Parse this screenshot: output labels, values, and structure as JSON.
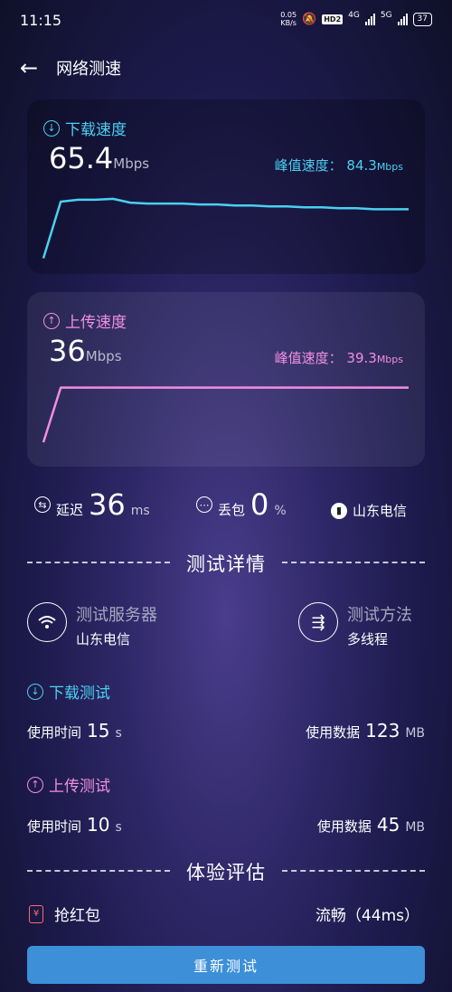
{
  "status_bar": {
    "time": "11:15",
    "net_speed_value": "0.05",
    "net_speed_unit": "KB/s",
    "hd_badge": "HD2",
    "network_1": "4G",
    "network_2": "5G",
    "battery": "37"
  },
  "header": {
    "title": "网络测速",
    "back_icon": "arrow-left-icon"
  },
  "download_card": {
    "label": "下载速度",
    "value": "65.4",
    "unit": "Mbps",
    "peak_label": "峰值速度：",
    "peak_value": "84.3",
    "peak_unit": "Mbps",
    "color": "#49d1f0"
  },
  "upload_card": {
    "label": "上传速度",
    "value": "36",
    "unit": "Mbps",
    "peak_label": "峰值速度：",
    "peak_value": "39.3",
    "peak_unit": "Mbps",
    "color": "#f08fe0"
  },
  "chart_data": [
    {
      "type": "line",
      "series": [
        {
          "values": [
            8,
            68,
            70,
            70,
            71,
            67,
            66,
            66,
            66,
            65,
            65,
            64,
            64,
            63,
            63,
            62,
            62,
            61,
            61,
            60,
            60,
            60
          ]
        }
      ],
      "ylim": [
        0,
        84.3
      ],
      "grid": false
    },
    {
      "type": "line",
      "series": [
        {
          "values": [
            8,
            35,
            35,
            35,
            35,
            35,
            35,
            35,
            35,
            35,
            35,
            35,
            35,
            35,
            35,
            35,
            35,
            35,
            35,
            35,
            35,
            35
          ]
        }
      ],
      "ylim": [
        0,
        39.3
      ],
      "grid": false
    }
  ],
  "stats": {
    "latency_label": "延迟",
    "latency_value": "36",
    "latency_unit": "ms",
    "loss_label": "丢包",
    "loss_value": "0",
    "loss_unit": "%",
    "isp": "山东电信"
  },
  "details": {
    "section_title": "测试详情",
    "server_title": "测试服务器",
    "server_value": "山东电信",
    "method_title": "测试方法",
    "method_value": "多线程",
    "download_title": "下载测试",
    "download_time_label": "使用时间",
    "download_time_value": "15",
    "download_time_unit": "s",
    "download_data_label": "使用数据",
    "download_data_value": "123",
    "download_data_unit": "MB",
    "upload_title": "上传测试",
    "upload_time_label": "使用时间",
    "upload_time_value": "10",
    "upload_time_unit": "s",
    "upload_data_label": "使用数据",
    "upload_data_value": "45",
    "upload_data_unit": "MB"
  },
  "experience": {
    "section_title": "体验评估",
    "item_label": "抢红包",
    "item_result": "流畅（44ms）"
  },
  "retest_button": "重新测试"
}
